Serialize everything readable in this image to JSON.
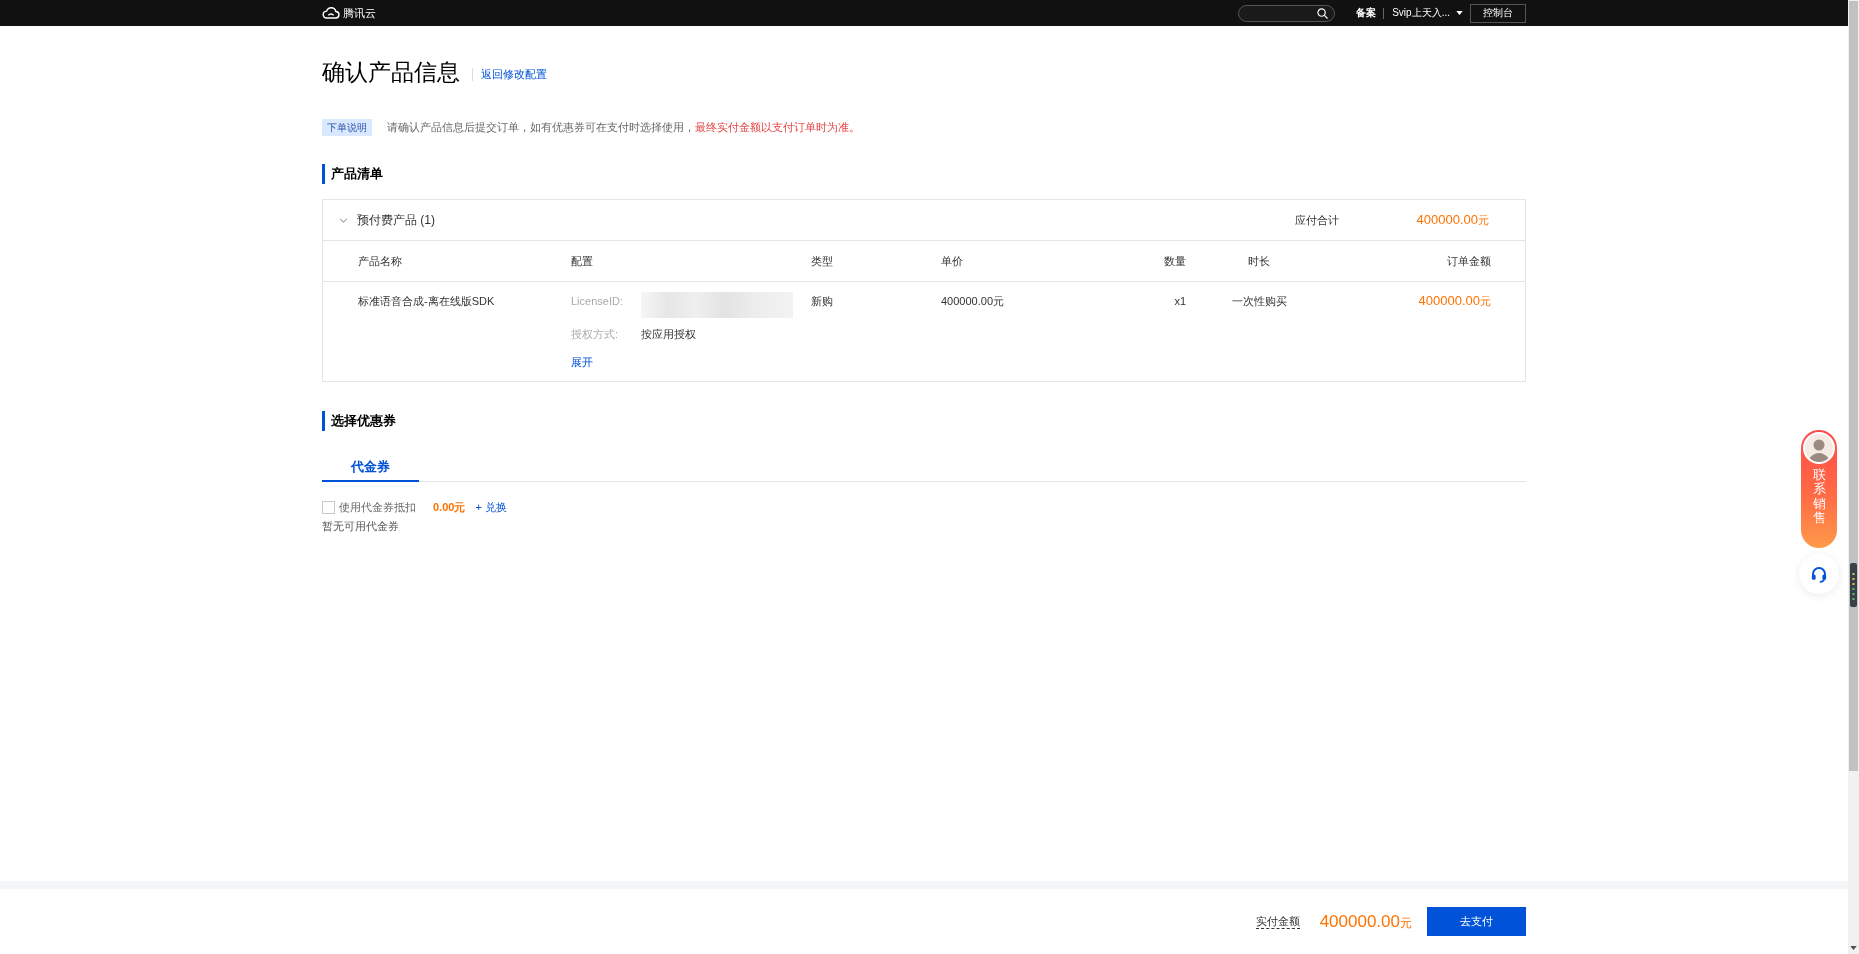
{
  "top_bar": {
    "logo_text": "腾讯云",
    "filing_link": "备案",
    "account": "Svip上天入...",
    "console_button": "控制台"
  },
  "page": {
    "title": "确认产品信息",
    "back_link": "返回修改配置"
  },
  "notice": {
    "badge": "下单说明",
    "text": "请确认产品信息后提交订单，如有优惠券可在支付时选择使用，",
    "highlight": "最终实付金额以支付订单时为准。"
  },
  "product_list": {
    "title": "产品清单",
    "group": {
      "label": "预付费产品 (1)",
      "expanded": true,
      "total_label": "应付合计",
      "total": "400000.00",
      "currency": "元"
    },
    "columns": [
      "产品名称",
      "配置",
      "类型",
      "单价",
      "数量",
      "时长",
      "订单金额"
    ],
    "rows": [
      {
        "name": "标准语音合成-离在线版SDK",
        "config": [
          {
            "kind": "redacted",
            "label": "LicenseID:"
          },
          {
            "kind": "text",
            "label": "授权方式:",
            "value": "按应用授权"
          }
        ],
        "expand_link": "展开",
        "type": "新购",
        "unit_price": "400000.00元",
        "quantity": "x1",
        "duration": "一次性购买",
        "amount": "400000.00",
        "currency": "元"
      }
    ]
  },
  "coupons": {
    "title": "选择优惠券",
    "tabs": [
      {
        "label": "代金券",
        "selected": true
      }
    ],
    "use_checkbox": {
      "label": "使用代金券抵扣",
      "checked": false
    },
    "discount": "0.00元",
    "redeem_link": "+ 兑换",
    "empty_text": "暂无可用代金券"
  },
  "footer": {
    "label": "实付金额",
    "amount": "400000.00",
    "currency": "元",
    "pay_button": "去支付"
  },
  "float_widget": {
    "contact_label": "联系销售"
  }
}
